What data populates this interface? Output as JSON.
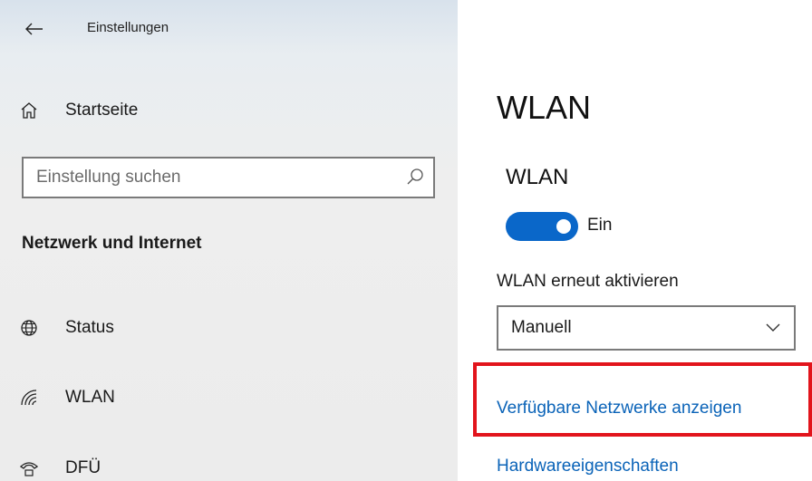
{
  "window": {
    "title": "Einstellungen"
  },
  "sidebar": {
    "home_label": "Startseite",
    "search": {
      "placeholder": "Einstellung suchen",
      "value": ""
    },
    "section_heading": "Netzwerk und Internet",
    "items": [
      {
        "label": "Status",
        "icon": "globe-icon"
      },
      {
        "label": "WLAN",
        "icon": "wifi-icon"
      },
      {
        "label": "DFÜ",
        "icon": "dialup-icon"
      }
    ]
  },
  "main": {
    "page_title": "WLAN",
    "wifi_heading": "WLAN",
    "toggle": {
      "state_label": "Ein",
      "on": true
    },
    "reenable": {
      "label": "WLAN erneut aktivieren",
      "selected": "Manuell"
    },
    "links": {
      "show_networks": "Verfügbare Netzwerke anzeigen",
      "hardware_properties": "Hardwareeigenschaften"
    }
  },
  "colors": {
    "accent": "#0a67c9",
    "link": "#0a63b8",
    "highlight": "#e2141c",
    "sidebar_bg": "#ececec"
  }
}
